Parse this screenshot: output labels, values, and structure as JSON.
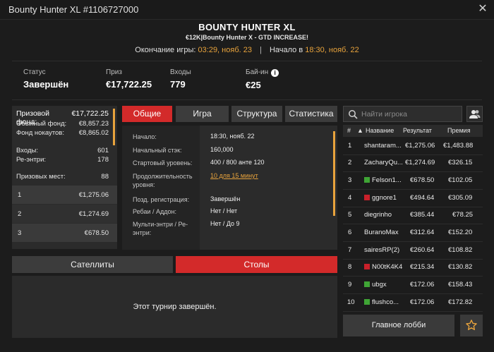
{
  "window": {
    "title": "Bounty Hunter XL #1106727000",
    "close_glyph": "✕"
  },
  "header": {
    "title": "BOUNTY HUNTER XL",
    "subtitle": "€12K|Bounty Hunter X - GTD INCREASE!",
    "end_label": "Окончание игры:",
    "end_value": "03:29, нояб. 23",
    "start_label": "Начало в",
    "start_value": "18:30, нояб. 22",
    "separator": "|"
  },
  "info": {
    "status_label": "Статус",
    "status_value": "Завершён",
    "prize_label": "Приз",
    "prize_value": "€17,722.25",
    "entries_label": "Входы",
    "entries_value": "779",
    "buyin_label": "Бай-ин",
    "buyin_value": "€25",
    "info_icon_glyph": "i"
  },
  "prize_panel": {
    "pool_label": "Призовой фонд:",
    "pool_value": "€17,722.25",
    "regular_label": "Обычный фонд:",
    "regular_value": "€8,857.23",
    "knockout_label": "Фонд нокаутов:",
    "knockout_value": "€8,865.02",
    "entries_label": "Входы:",
    "entries_value": "601",
    "reentries_label": "Ре-энтри:",
    "reentries_value": "178",
    "places_label": "Призовых мест:",
    "places_value": "88",
    "payouts": [
      {
        "place": "1",
        "amount": "€1,275.06"
      },
      {
        "place": "2",
        "amount": "€1,274.69"
      },
      {
        "place": "3",
        "amount": "€678.50"
      }
    ]
  },
  "tabs": [
    "Общие",
    "Игра",
    "Структура",
    "Статистика"
  ],
  "general": [
    {
      "key": "Начало:",
      "value": "18:30, нояб. 22"
    },
    {
      "key": "Начальный стэк:",
      "value": "160,000"
    },
    {
      "key": "Стартовый уровень:",
      "value": "400 / 800 анте 120"
    },
    {
      "key": "Продолжительность уровня:",
      "value": "10 для 15 минут"
    },
    {
      "key": "Позд. регистрация:",
      "value": "Завершён"
    },
    {
      "key": "Ребаи / Аддон:",
      "value": "Нет / Нет"
    },
    {
      "key": "Мульти-энтри / Ре-энтри:",
      "value": "Нет / До 9"
    }
  ],
  "bottom_tabs": {
    "satellites": "Сателлиты",
    "tables": "Столы"
  },
  "tables_message": "Этот турнир завершён.",
  "search": {
    "placeholder": "Найти игрока"
  },
  "ranking": {
    "headers": {
      "rank": "#",
      "sort": "▲",
      "name": "Название",
      "result": "Результат",
      "prize": "Премия"
    },
    "rows": [
      {
        "rank": "1",
        "name": "shantaram...",
        "result": "€1,275.06",
        "prize": "€1,483.88",
        "flag": ""
      },
      {
        "rank": "2",
        "name": "ZacharyQu...",
        "result": "€1,274.69",
        "prize": "€326.15",
        "flag": ""
      },
      {
        "rank": "3",
        "name": "Felson1...",
        "result": "€678.50",
        "prize": "€102.05",
        "flag": "#3fa535"
      },
      {
        "rank": "4",
        "name": "ggnore1",
        "result": "€494.64",
        "prize": "€305.09",
        "flag": "#c8202a"
      },
      {
        "rank": "5",
        "name": "diegrinho",
        "result": "€385.44",
        "prize": "€78.25",
        "flag": ""
      },
      {
        "rank": "6",
        "name": "BuranoMax",
        "result": "€312.64",
        "prize": "€152.20",
        "flag": ""
      },
      {
        "rank": "7",
        "name": "sairesRP(2)",
        "result": "€260.64",
        "prize": "€108.82",
        "flag": ""
      },
      {
        "rank": "8",
        "name": "N00tK4K4",
        "result": "€215.34",
        "prize": "€130.82",
        "flag": "#c8202a"
      },
      {
        "rank": "9",
        "name": "ubgx",
        "result": "€172.06",
        "prize": "€158.43",
        "flag": "#3fa535"
      },
      {
        "rank": "10",
        "name": "flushco...",
        "result": "€172.06",
        "prize": "€172.82",
        "flag": "#3fa535"
      }
    ]
  },
  "lobby_button": "Главное лобби",
  "colors": {
    "accent_red": "#d32a2a",
    "accent_orange": "#e8a33c",
    "background": "#1c1c1c"
  }
}
